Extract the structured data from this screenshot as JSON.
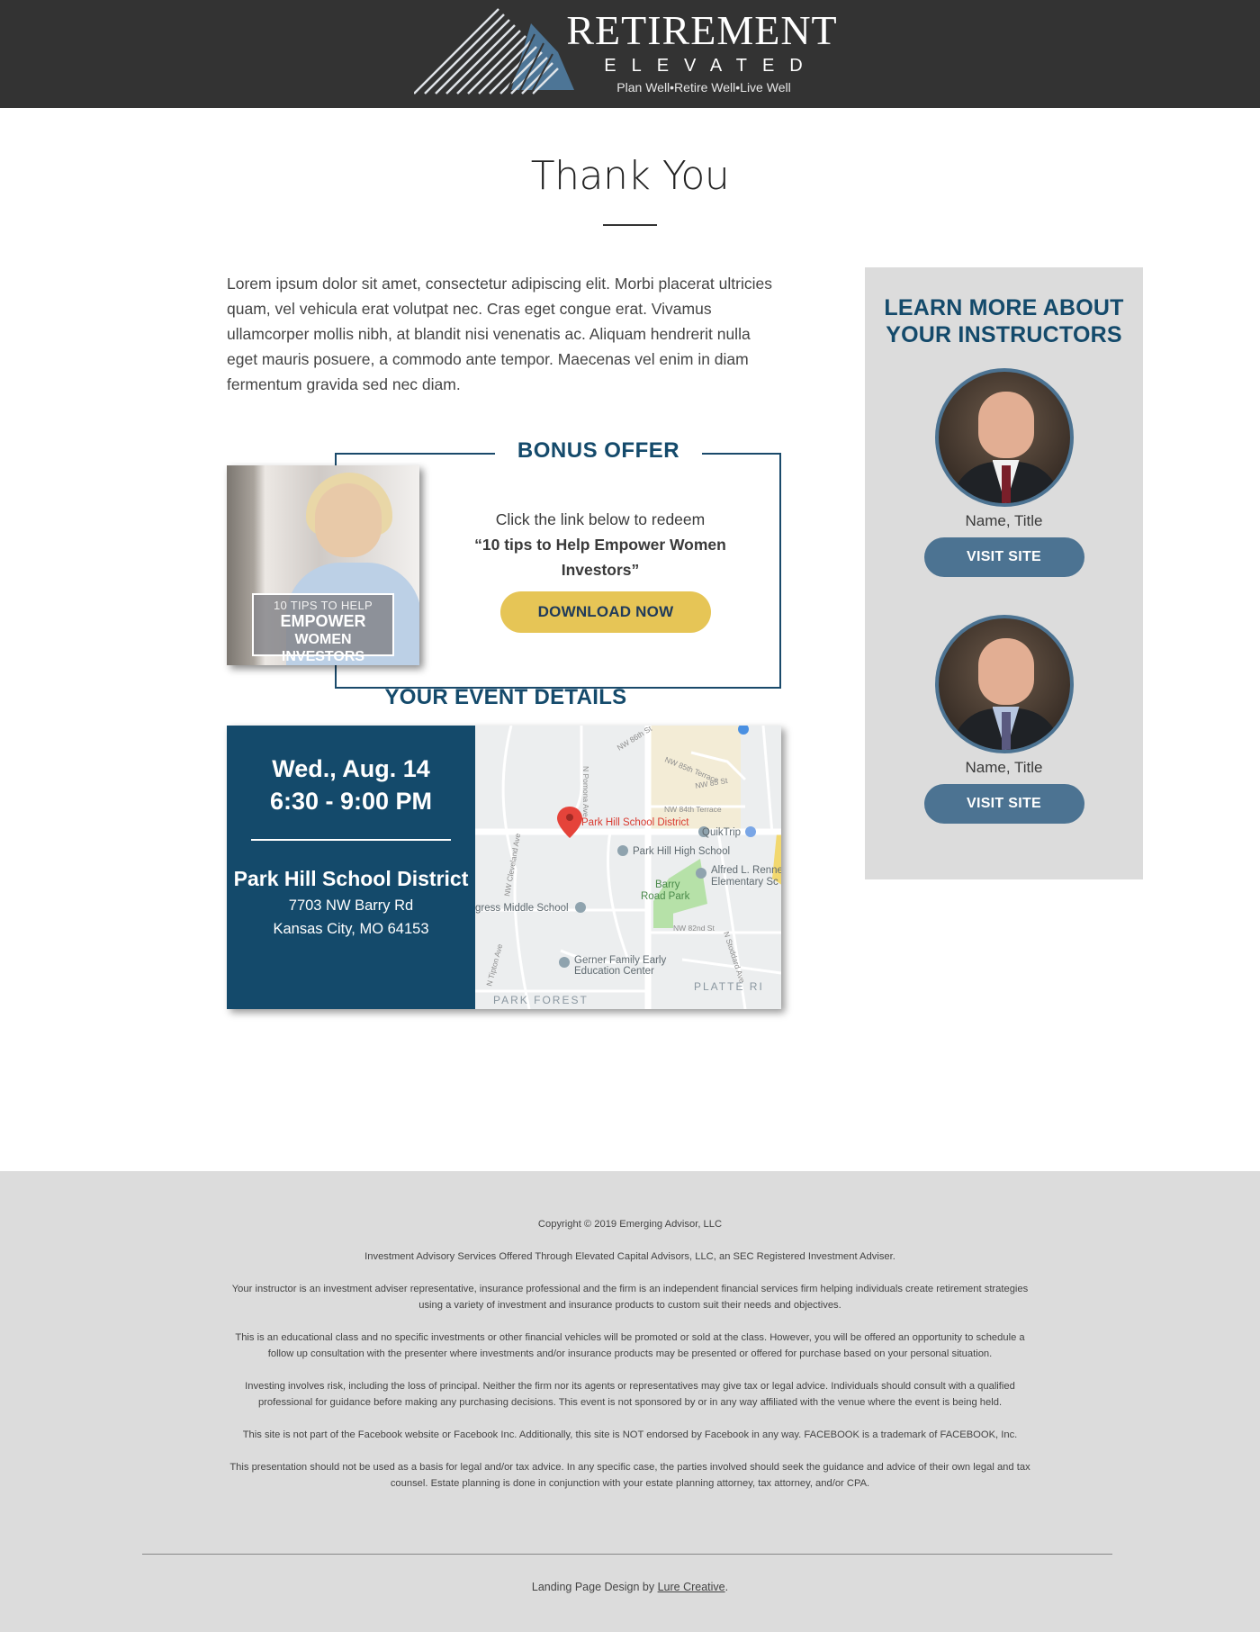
{
  "header": {
    "logo_title": "RETIREMENT",
    "logo_subtitle": "ELEVATED",
    "logo_tagline": "Plan Well•Retire Well•Live Well"
  },
  "page_title": "Thank You",
  "intro_text": "Lorem ipsum dolor sit amet, consectetur adipiscing elit. Morbi placerat ultricies quam, vel vehicula erat volutpat nec. Cras eget congue erat. Vivamus ullamcorper mollis nibh, at blandit nisi venenatis ac. Aliquam hendrerit nulla eget mauris posuere, a commodo ante tempor. Maecenas vel enim in diam fermentum gravida sed nec diam.",
  "bonus": {
    "heading": "BONUS OFFER",
    "line1": "Click the link below to redeem",
    "line2": "“10 tips to Help Empower Women Investors”",
    "button": "DOWNLOAD NOW",
    "ebook": {
      "line1": "10 TIPS TO HELP",
      "line2": "EMPOWER",
      "line3": "WOMEN INVESTORS"
    }
  },
  "event": {
    "heading": "YOUR EVENT DETAILS",
    "date": "Wed., Aug. 14",
    "time": "6:30 - 9:00 PM",
    "venue": "Park Hill School District",
    "address1": "7703 NW Barry Rd",
    "address2": "Kansas City, MO 64153",
    "map": {
      "pin_label": "Park Hill School District",
      "places": [
        "Park Hill High School",
        "QuikTrip",
        "Alfred L. Renne",
        "Elementary Sc",
        "Barry",
        "Road Park",
        "gress Middle School",
        "Gerner Family Early",
        "Education Center",
        "PLATTE RI",
        "PARK FOREST"
      ],
      "streets": [
        "NW 86th St",
        "NW 85th Terrace",
        "NW 85 St",
        "NW 84th Terrace",
        "N Pomona Ave",
        "NW Cleveland Ave",
        "NW 82nd St",
        "N Stoddard Ave",
        "N Tipton Ave"
      ]
    }
  },
  "sidebar": {
    "heading": "LEARN MORE ABOUT YOUR INSTRUCTORS",
    "instructors": [
      {
        "name": "Name, Title",
        "button": "VISIT SITE"
      },
      {
        "name": "Name, Title",
        "button": "VISIT SITE"
      }
    ]
  },
  "footer": {
    "copyright": "Copyright © 2019 Emerging Advisor, LLC",
    "p1": "Investment Advisory Services Offered Through Elevated Capital Advisors, LLC, an SEC Registered Investment Adviser.",
    "p2": "Your instructor is an investment adviser representative, insurance professional and the firm is an independent financial services firm helping individuals create retirement strategies using a variety of investment and insurance products to custom suit their needs and objectives.",
    "p3": "This is an educational class and no specific investments or other financial vehicles will be promoted or sold at the class. However, you will be offered an opportunity to schedule a follow up consultation with the presenter where investments and/or insurance products may be presented or offered for purchase based on your personal situation.",
    "p4": "Investing involves risk, including the loss of principal. Neither the firm nor its agents or representatives may give tax or legal advice. Individuals should consult with a qualified professional for guidance before making any purchasing decisions. This event is not sponsored by or in any way affiliated with the venue where the event is being held.",
    "p5": "This site is not part of the Facebook website or Facebook Inc. Additionally, this site is NOT endorsed by Facebook in any way. FACEBOOK is a trademark of FACEBOOK, Inc.",
    "p6": "This presentation should not be used as a basis for legal and/or tax advice. In any specific case, the parties involved should seek the guidance and advice of their own legal and tax counsel. Estate planning is done in conjunction with your estate planning attorney, tax attorney, and/or CPA.",
    "credit_prefix": "Landing Page Design by",
    "credit_link": "Lure Creative",
    "credit_suffix": "."
  },
  "colors": {
    "header_bg": "#333333",
    "brand_navy": "#144a6b",
    "button_blue": "#4c7392",
    "button_gold": "#e6c556",
    "panel_gray": "#dcdcdc"
  }
}
